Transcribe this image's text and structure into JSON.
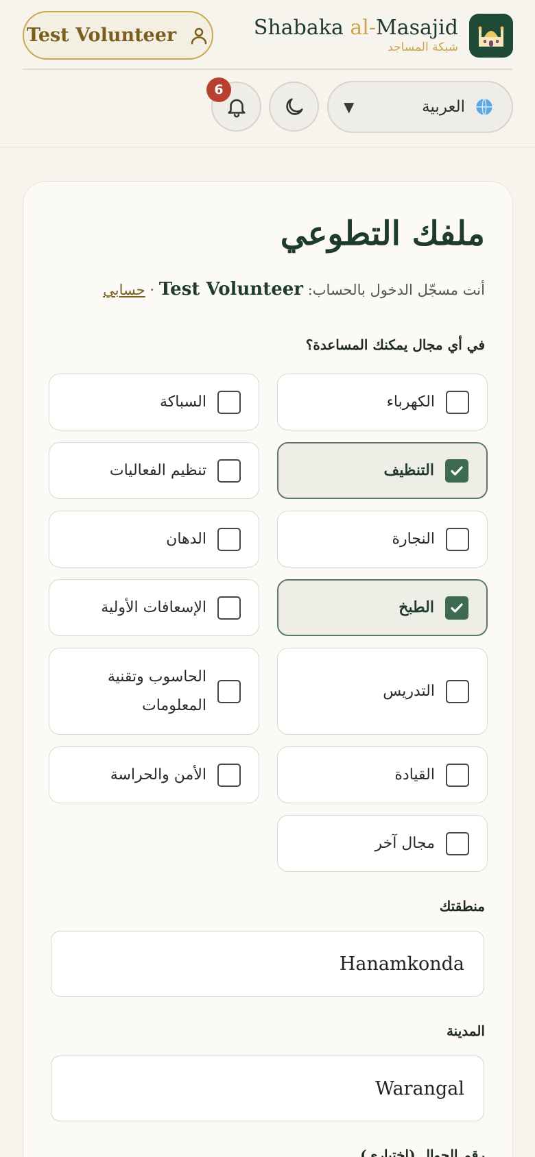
{
  "header": {
    "user_button_label": "Test Volunteer",
    "brand_name_prefix": "Shabaka ",
    "brand_name_al": "al-",
    "brand_name_suffix": "Masajid",
    "brand_subtitle": "شبكة المساجد",
    "language_selected": "العربية",
    "notification_count": "6"
  },
  "page": {
    "title": "ملفك التطوعي",
    "logged_in_prefix": "أنت مسجّل الدخول بالحساب:",
    "username": "Test Volunteer",
    "separator": "·",
    "account_link": "حسابي",
    "skills_question": "في أي مجال يمكنك المساعدة؟"
  },
  "skills": [
    {
      "label": "الكهرباء",
      "checked": false
    },
    {
      "label": "السباكة",
      "checked": false
    },
    {
      "label": "التنظيف",
      "checked": true
    },
    {
      "label": "تنظيم الفعاليات",
      "checked": false
    },
    {
      "label": "النجارة",
      "checked": false
    },
    {
      "label": "الدهان",
      "checked": false
    },
    {
      "label": "الطبخ",
      "checked": true
    },
    {
      "label": "الإسعافات الأولية",
      "checked": false
    },
    {
      "label": "التدريس",
      "checked": false
    },
    {
      "label": "الحاسوب وتقنية المعلومات",
      "checked": false
    },
    {
      "label": "القيادة",
      "checked": false
    },
    {
      "label": "الأمن والحراسة",
      "checked": false
    },
    {
      "label": "مجال آخر",
      "checked": false
    }
  ],
  "fields": {
    "area_label": "منطقتك",
    "area_value": "Hanamkonda",
    "city_label": "المدينة",
    "city_value": "Warangal",
    "phone_label": "رقم الجوال (اختياري)"
  },
  "colors": {
    "accent_gold": "#c9a84c",
    "primary_green": "#1f3a2e",
    "badge_red": "#b8402f",
    "checked_green": "#3f6a52"
  }
}
